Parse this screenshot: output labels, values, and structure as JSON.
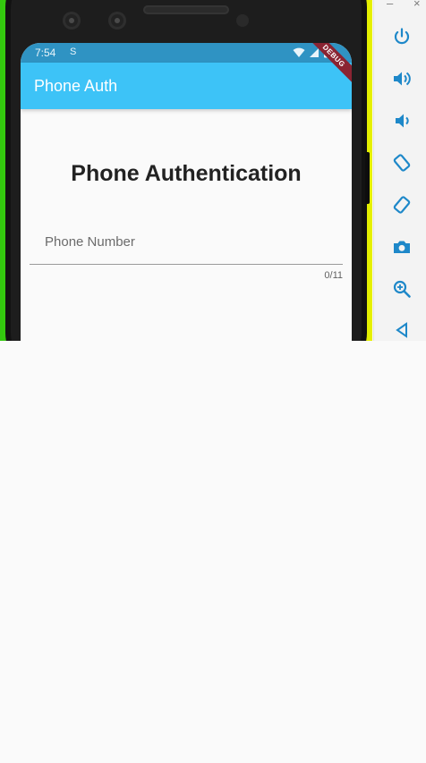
{
  "status_bar": {
    "time": "7:54",
    "sim_indicator": "S"
  },
  "debug_banner": {
    "label": "DEBUG"
  },
  "app_bar": {
    "title": "Phone Auth"
  },
  "main": {
    "heading": "Phone Authentication",
    "phone_field": {
      "label": "Phone Number",
      "value": "",
      "counter": "0/11"
    }
  },
  "emulator_panel": {
    "window_controls": {
      "minimize": "–",
      "close": "×"
    },
    "tools": [
      "power-icon",
      "volume-up-icon",
      "volume-down-icon",
      "rotate-left-icon",
      "rotate-right-icon",
      "camera-icon",
      "zoom-icon",
      "back-icon"
    ]
  },
  "colors": {
    "app_bar": "#3dc3f7",
    "status_bar": "#2f93c3",
    "tool_icons": "#1e88c9",
    "debug_ribbon": "#8a2432"
  }
}
